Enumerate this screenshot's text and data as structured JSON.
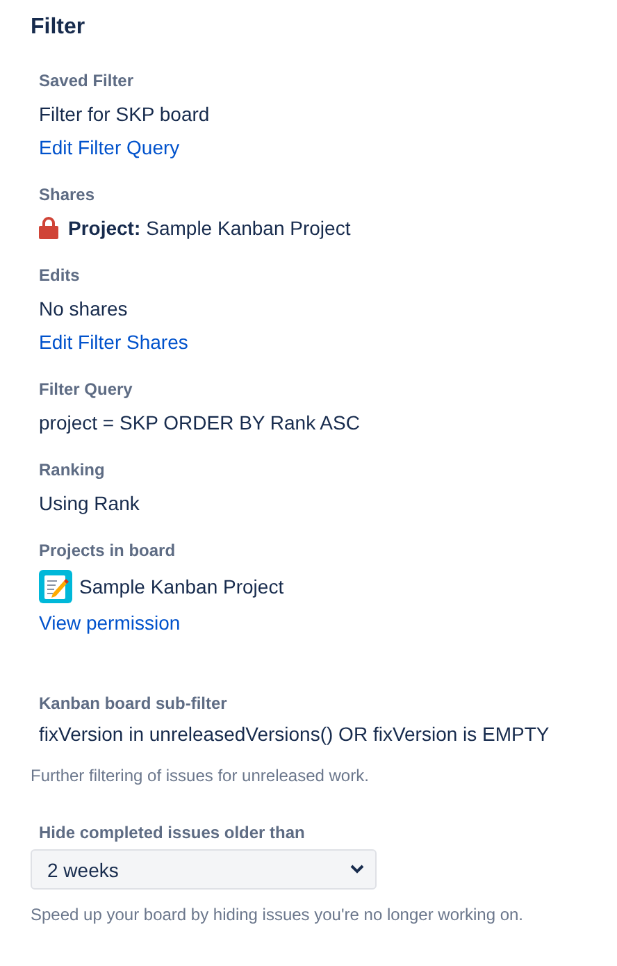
{
  "title": "Filter",
  "sections": [
    {
      "label": "Saved Filter",
      "items": [
        {
          "kind": "text",
          "text": "Filter for SKP board"
        },
        {
          "kind": "link",
          "text": "Edit Filter Query"
        }
      ]
    },
    {
      "label": "Shares",
      "items": [
        {
          "kind": "share",
          "prefix": "Project:",
          "text": "Sample Kanban Project"
        }
      ]
    },
    {
      "label": "Edits",
      "items": [
        {
          "kind": "text",
          "text": "No shares"
        },
        {
          "kind": "link",
          "text": "Edit Filter Shares"
        }
      ]
    },
    {
      "label": "Filter Query",
      "items": [
        {
          "kind": "text",
          "text": "project = SKP ORDER BY Rank ASC"
        }
      ]
    },
    {
      "label": "Ranking",
      "items": [
        {
          "kind": "text",
          "text": "Using Rank"
        }
      ]
    },
    {
      "label": "Projects in board",
      "items": [
        {
          "kind": "project",
          "text": "Sample Kanban Project"
        },
        {
          "kind": "link",
          "text": "View permission"
        }
      ]
    }
  ],
  "subfilter": {
    "label": "Kanban board sub-filter",
    "value": "fixVersion in unreleasedVersions() OR fixVersion is EMPTY",
    "help": "Further filtering of issues for unreleased work."
  },
  "hide_completed": {
    "label": "Hide completed issues older than",
    "value": "2 weeks",
    "help": "Speed up your board by hiding issues you're no longer working on."
  }
}
